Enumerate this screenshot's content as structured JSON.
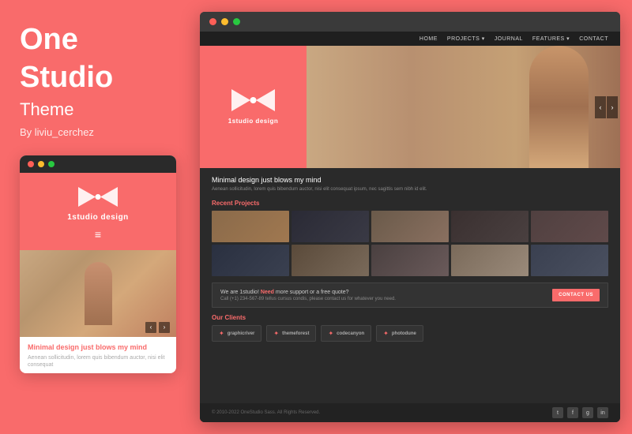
{
  "left": {
    "title_line1": "One",
    "title_line2": "Studio",
    "subtitle": "Theme",
    "author": "By liviu_cerchez",
    "logo_text": "1studio design",
    "mobile": {
      "caption_title_normal": "Minimal design ",
      "caption_title_pink": "just blows my mind",
      "caption_text": "Aenean sollicitudin, lorem quis bibendum auctor, nisi elit consequat"
    }
  },
  "browser": {
    "nav_items": [
      "HOME",
      "PROJECTS ▾",
      "JOURNAL",
      "FEATURES ▾",
      "CONTACT"
    ],
    "logo_text": "1studio design",
    "headline_pink": "Minimal design ",
    "headline_white": "just blows my mind",
    "description": "Aenean sollicitudin, lorem quis bibendum auctor, nisi elit consequat ipsum, nec sagittis sem nibh id elit.",
    "recent_projects_label": "Recent Projects",
    "cta": {
      "prefix": "We are 1studio! ",
      "bold": "Need",
      "suffix": " more support or a free quote?",
      "sub": "Call (+1) 234-567-89 tellus cursus condis, please contact us for whatever you need.",
      "button": "CONTACT US"
    },
    "clients_label": "Our Clients",
    "clients": [
      {
        "icon": "✦",
        "name": "graphicriver"
      },
      {
        "icon": "✦",
        "name": "themeforest"
      },
      {
        "icon": "✦",
        "name": "codecanyon"
      },
      {
        "icon": "✦",
        "name": "photodune"
      }
    ],
    "footer_copy": "© 2010-2022 OneStudio Sass. All Rights Reserved.",
    "social_icons": [
      "t",
      "f",
      "g+",
      "in"
    ]
  },
  "colors": {
    "accent": "#f96b6b",
    "bg_dark": "#2d2d2d",
    "bg_darker": "#1f1f1f",
    "text_light": "#cccccc",
    "text_muted": "#888888"
  }
}
